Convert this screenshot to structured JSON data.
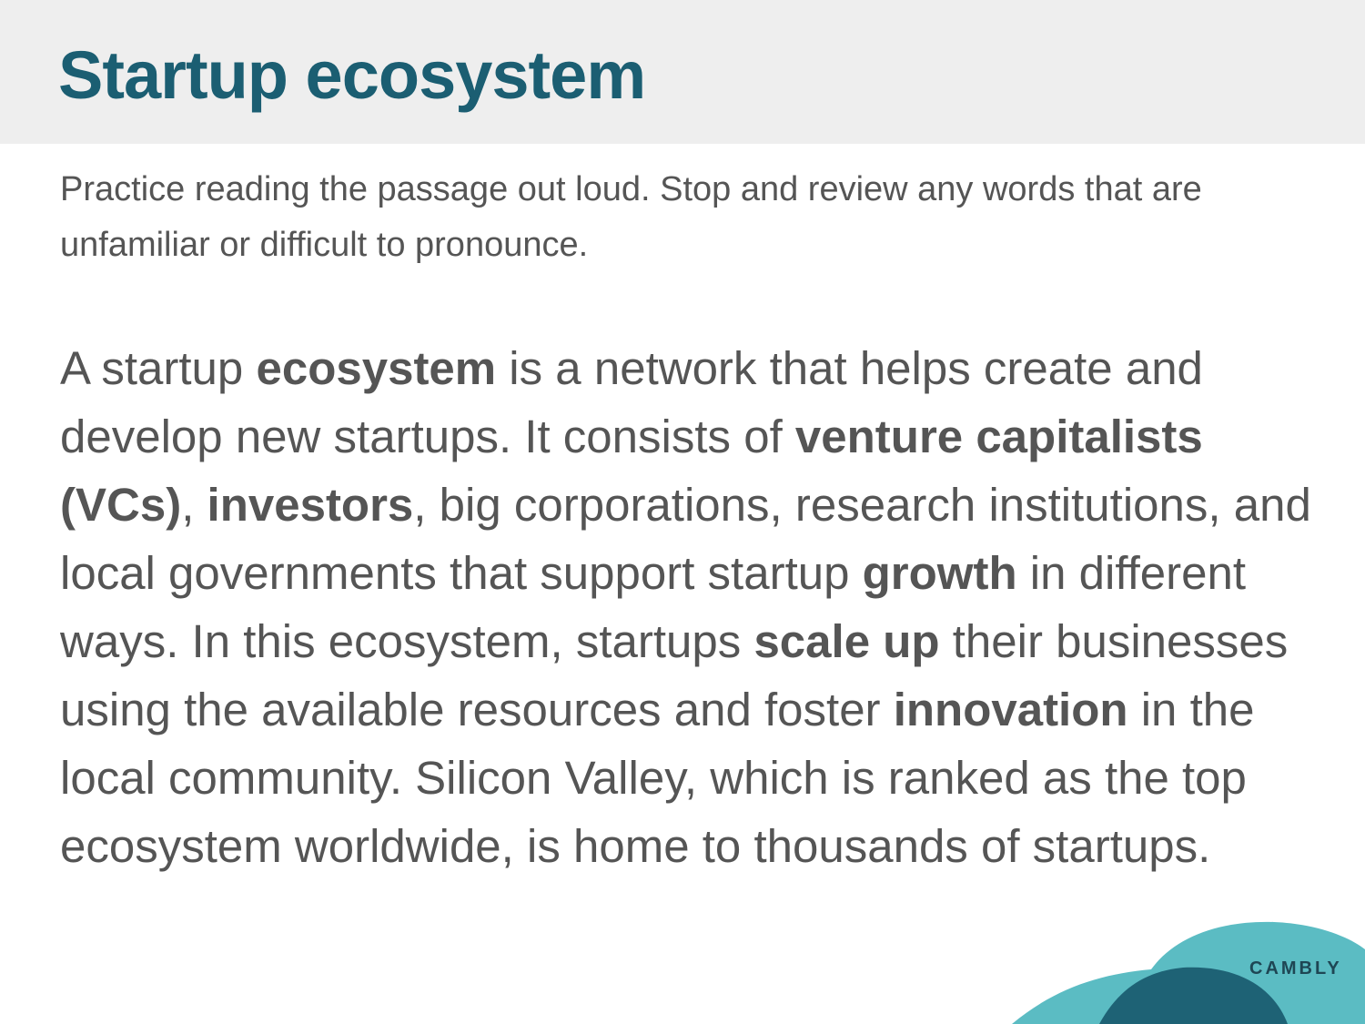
{
  "colors": {
    "title": "#1b5e72",
    "body_text": "#555555",
    "header_bg": "#eeeeee",
    "wave_light": "#5bbcc3",
    "wave_dark": "#1e6275",
    "brand": "#1e4654"
  },
  "slide": {
    "title": "Startup ecosystem",
    "instructions": "Practice reading the passage out loud. Stop and review any words that are unfamiliar or difficult to pronounce.",
    "passage": [
      {
        "text": "A startup ",
        "bold": false
      },
      {
        "text": "ecosystem",
        "bold": true
      },
      {
        "text": " is a network that helps create and develop new startups. It consists of ",
        "bold": false
      },
      {
        "text": "venture capitalists (VCs)",
        "bold": true
      },
      {
        "text": ", ",
        "bold": false
      },
      {
        "text": "investors",
        "bold": true
      },
      {
        "text": ", big corporations, research institutions, and local governments that support startup ",
        "bold": false
      },
      {
        "text": "growth",
        "bold": true
      },
      {
        "text": " in different ways. In this ecosystem, startups ",
        "bold": false
      },
      {
        "text": "scale up",
        "bold": true
      },
      {
        "text": " their businesses using the available resources and foster ",
        "bold": false
      },
      {
        "text": "innovation",
        "bold": true
      },
      {
        "text": " in the local community. Silicon Valley, which is ranked as the top ecosystem worldwide, is home to thousands of startups.",
        "bold": false
      }
    ],
    "brand": "CAMBLY"
  }
}
